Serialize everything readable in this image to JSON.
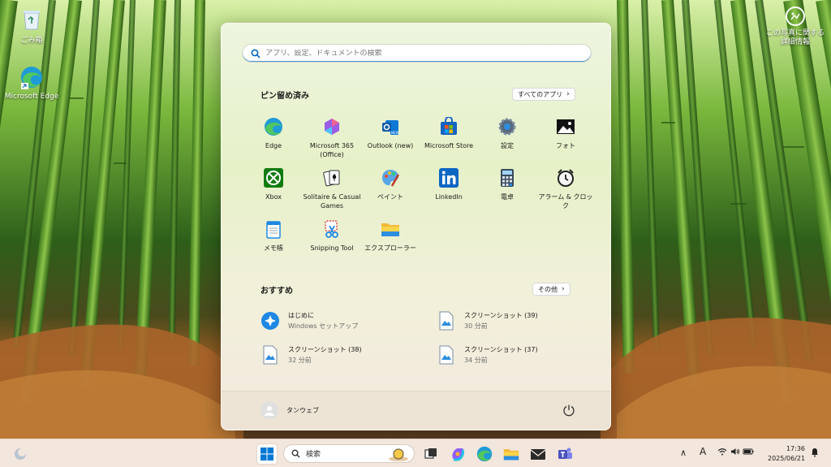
{
  "desktop": {
    "icons": [
      {
        "label": "ごみ箱",
        "icon": "recycle-bin-icon"
      },
      {
        "label": "Microsoft Edge",
        "icon": "edge-icon"
      }
    ],
    "photo_info": {
      "label": "この写真に関する詳細情報",
      "icon": "photo-info-icon"
    }
  },
  "start_menu": {
    "search": {
      "placeholder": "アプリ、設定、ドキュメントの検索"
    },
    "pinned": {
      "title": "ピン留め済み",
      "all_apps_label": "すべてのアプリ",
      "apps": [
        {
          "label": "Edge",
          "icon": "edge-icon"
        },
        {
          "label": "Microsoft 365 (Office)",
          "icon": "microsoft-365-icon"
        },
        {
          "label": "Outlook (new)",
          "icon": "outlook-icon"
        },
        {
          "label": "Microsoft Store",
          "icon": "store-icon"
        },
        {
          "label": "設定",
          "icon": "settings-gear-icon"
        },
        {
          "label": "フォト",
          "icon": "photos-icon"
        },
        {
          "label": "Xbox",
          "icon": "xbox-icon"
        },
        {
          "label": "Solitaire & Casual Games",
          "icon": "solitaire-icon"
        },
        {
          "label": "ペイント",
          "icon": "paint-icon"
        },
        {
          "label": "LinkedIn",
          "icon": "linkedin-icon"
        },
        {
          "label": "電卓",
          "icon": "calculator-icon"
        },
        {
          "label": "アラーム & クロック",
          "icon": "alarm-clock-icon"
        },
        {
          "label": "メモ帳",
          "icon": "notepad-icon"
        },
        {
          "label": "Snipping Tool",
          "icon": "snipping-tool-icon"
        },
        {
          "label": "エクスプローラー",
          "icon": "file-explorer-icon"
        }
      ]
    },
    "recommended": {
      "title": "おすすめ",
      "more_label": "その他",
      "items": [
        {
          "title": "はじめに",
          "subtitle": "Windows セットアップ",
          "icon": "get-started-icon"
        },
        {
          "title": "スクリーンショット (39)",
          "subtitle": "30 分前",
          "icon": "image-file-icon"
        },
        {
          "title": "スクリーンショット (38)",
          "subtitle": "32 分前",
          "icon": "image-file-icon"
        },
        {
          "title": "スクリーンショット (37)",
          "subtitle": "34 分前",
          "icon": "image-file-icon"
        }
      ]
    },
    "footer": {
      "user_name": "タンウェブ"
    }
  },
  "taskbar": {
    "search_label": "検索",
    "clock": {
      "time": "17:36",
      "date": "2025/06/21"
    },
    "ime_label": "A",
    "colors": {
      "accent": "#0067c0",
      "taskbar_bg": "#f3e6dc"
    }
  }
}
